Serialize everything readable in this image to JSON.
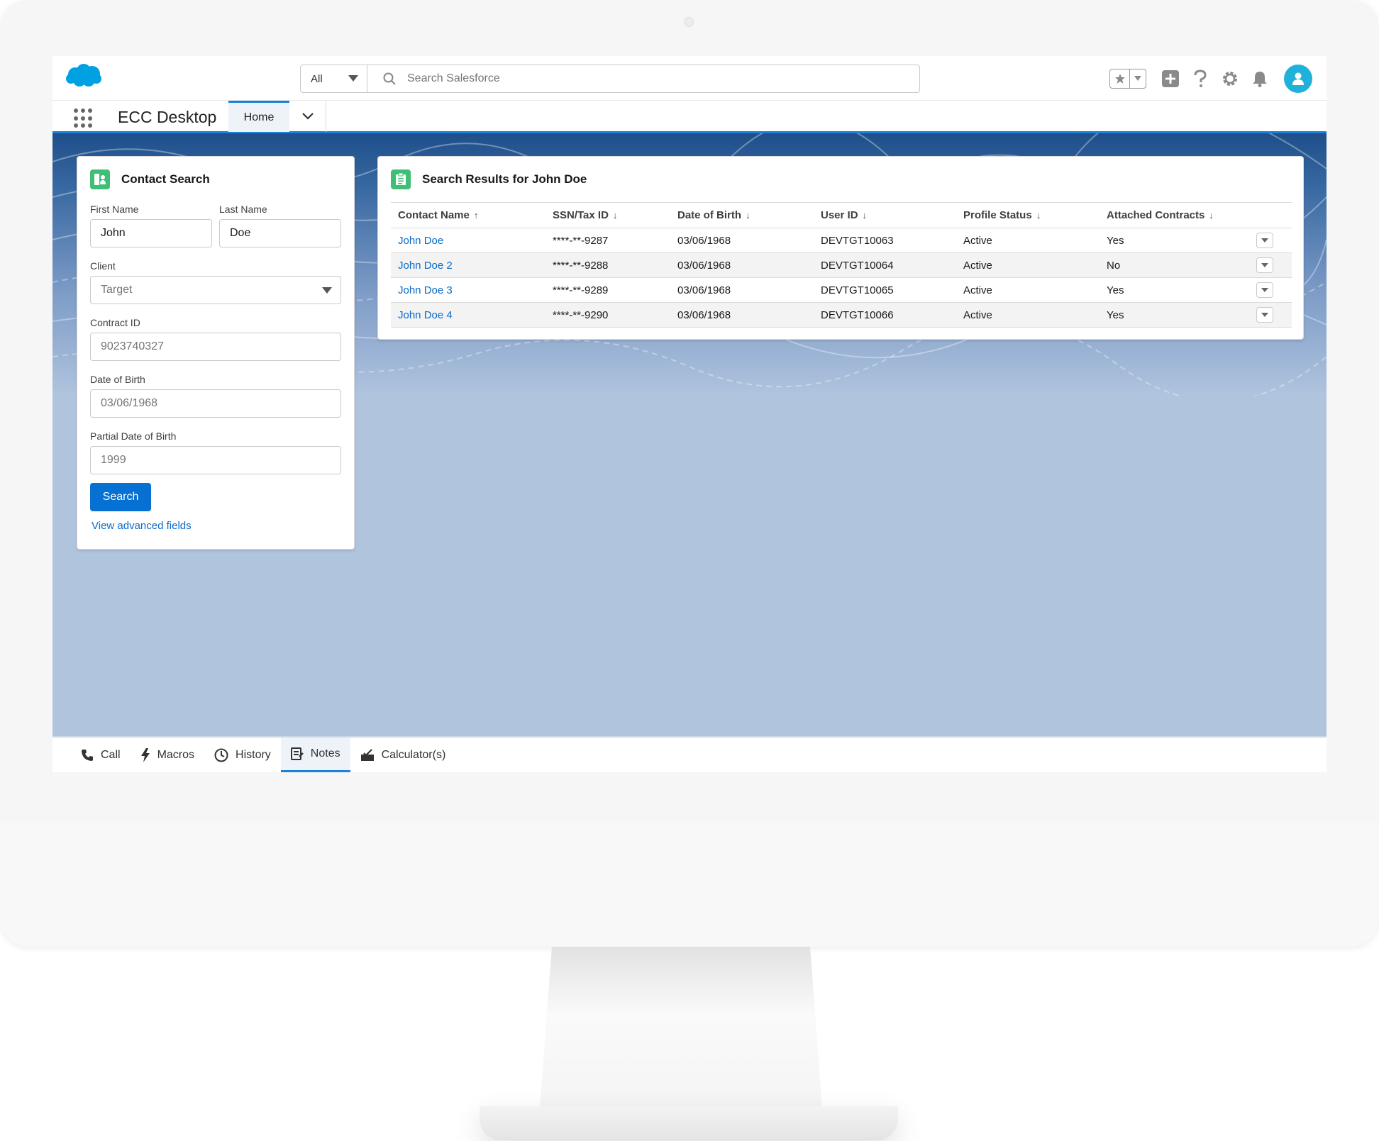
{
  "header": {
    "search_scope": "All",
    "search_placeholder": "Search Salesforce"
  },
  "nav": {
    "app_name": "ECC Desktop",
    "tabs": [
      {
        "label": "Home"
      }
    ]
  },
  "contact_search": {
    "title": "Contact Search",
    "first_name_label": "First Name",
    "first_name_value": "John",
    "last_name_label": "Last Name",
    "last_name_value": "Doe",
    "client_label": "Client",
    "client_value": "Target",
    "contract_id_label": "Contract ID",
    "contract_id_placeholder": "9023740327",
    "dob_label": "Date of Birth",
    "dob_placeholder": "03/06/1968",
    "partial_dob_label": "Partial Date of Birth",
    "partial_dob_placeholder": "1999",
    "search_button": "Search",
    "advanced_link": "View advanced fields"
  },
  "results": {
    "title": "Search Results for John Doe",
    "columns": [
      {
        "label": "Contact Name",
        "arrow": "↑"
      },
      {
        "label": "SSN/Tax ID",
        "arrow": "↓"
      },
      {
        "label": "Date of Birth",
        "arrow": "↓"
      },
      {
        "label": "User ID",
        "arrow": "↓"
      },
      {
        "label": "Profile Status",
        "arrow": "↓"
      },
      {
        "label": "Attached Contracts",
        "arrow": "↓"
      }
    ],
    "rows": [
      {
        "name": "John Doe",
        "ssn": "****-**-9287",
        "dob": "03/06/1968",
        "user_id": "DEVTGT10063",
        "status": "Active",
        "contracts": "Yes"
      },
      {
        "name": "John Doe 2",
        "ssn": "****-**-9288",
        "dob": "03/06/1968",
        "user_id": "DEVTGT10064",
        "status": "Active",
        "contracts": "No"
      },
      {
        "name": "John Doe 3",
        "ssn": "****-**-9289",
        "dob": "03/06/1968",
        "user_id": "DEVTGT10065",
        "status": "Active",
        "contracts": "Yes"
      },
      {
        "name": "John Doe 4",
        "ssn": "****-**-9290",
        "dob": "03/06/1968",
        "user_id": "DEVTGT10066",
        "status": "Active",
        "contracts": "Yes"
      }
    ]
  },
  "utility_bar": {
    "items": [
      {
        "label": "Call",
        "icon": "phone-icon"
      },
      {
        "label": "Macros",
        "icon": "lightning-icon"
      },
      {
        "label": "History",
        "icon": "clock-icon"
      },
      {
        "label": "Notes",
        "icon": "notes-icon"
      },
      {
        "label": "Calculator(s)",
        "icon": "calculator-icon"
      }
    ],
    "active": "Notes"
  },
  "colors": {
    "brand_blue": "#0770d3",
    "link_blue": "#0b6bcb",
    "card_icon_green": "#3fbe76",
    "avatar_cyan": "#1fb1d9",
    "logo_blue": "#00a1e0"
  }
}
